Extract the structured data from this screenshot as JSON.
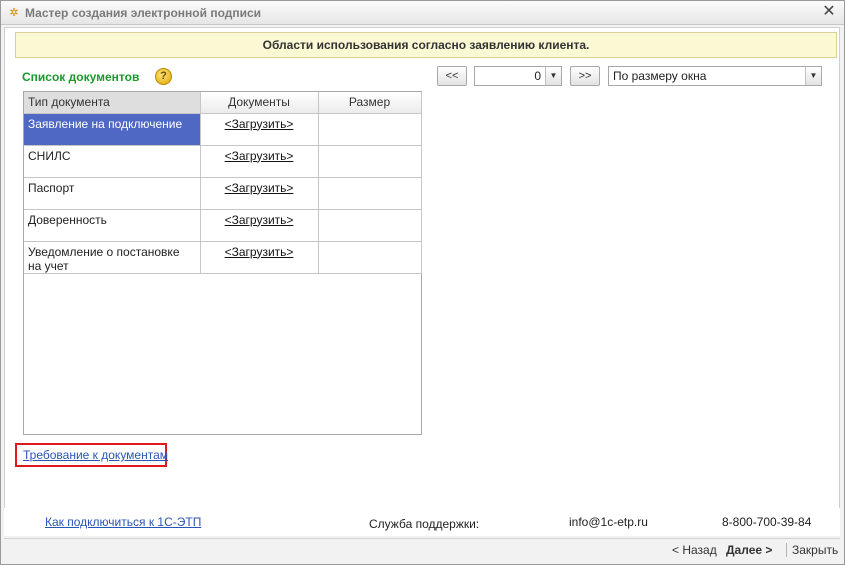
{
  "window": {
    "title": "Мастер создания электронной подписи",
    "close_glyph": "✕"
  },
  "banner": {
    "text": "Области использования согласно заявлению клиента."
  },
  "documents": {
    "title": "Список документов",
    "help_glyph": "?",
    "columns": [
      "Тип документа",
      "Документы",
      "Размер"
    ],
    "rows": [
      {
        "type": "Заявление на подключение",
        "doc": "<Загрузить>",
        "size": ""
      },
      {
        "type": "СНИЛС",
        "doc": "<Загрузить>",
        "size": ""
      },
      {
        "type": "Паспорт",
        "doc": "<Загрузить>",
        "size": ""
      },
      {
        "type": "Доверенность",
        "doc": "<Загрузить>",
        "size": ""
      },
      {
        "type": "Уведомление о постановке на учет",
        "doc": "<Загрузить>",
        "size": ""
      }
    ],
    "selected_row": 0,
    "requirements_link": "Требование к документам"
  },
  "viewer": {
    "prev_label": "<<",
    "next_label": ">>",
    "page_value": "0",
    "zoom_value": "По размеру окна"
  },
  "footer": {
    "how_to_connect": "Как подключиться к 1С-ЭТП",
    "support_label": "Служба поддержки:",
    "support_email": "info@1c-etp.ru",
    "support_phone": "8-800-700-39-84"
  },
  "buttons": {
    "back": "< Назад",
    "next": "Далее >",
    "close": "Закрыть"
  },
  "colors": {
    "banner_bg": "#fbf8d4",
    "list_title": "#1a9a2a",
    "selection": "#4f68c4",
    "link": "#2a55b5",
    "highlight_box": "#e01a1a"
  },
  "icons": {
    "app": "app-icon",
    "help": "help-icon",
    "dropdown": "chevron-down-icon",
    "close": "close-icon"
  }
}
